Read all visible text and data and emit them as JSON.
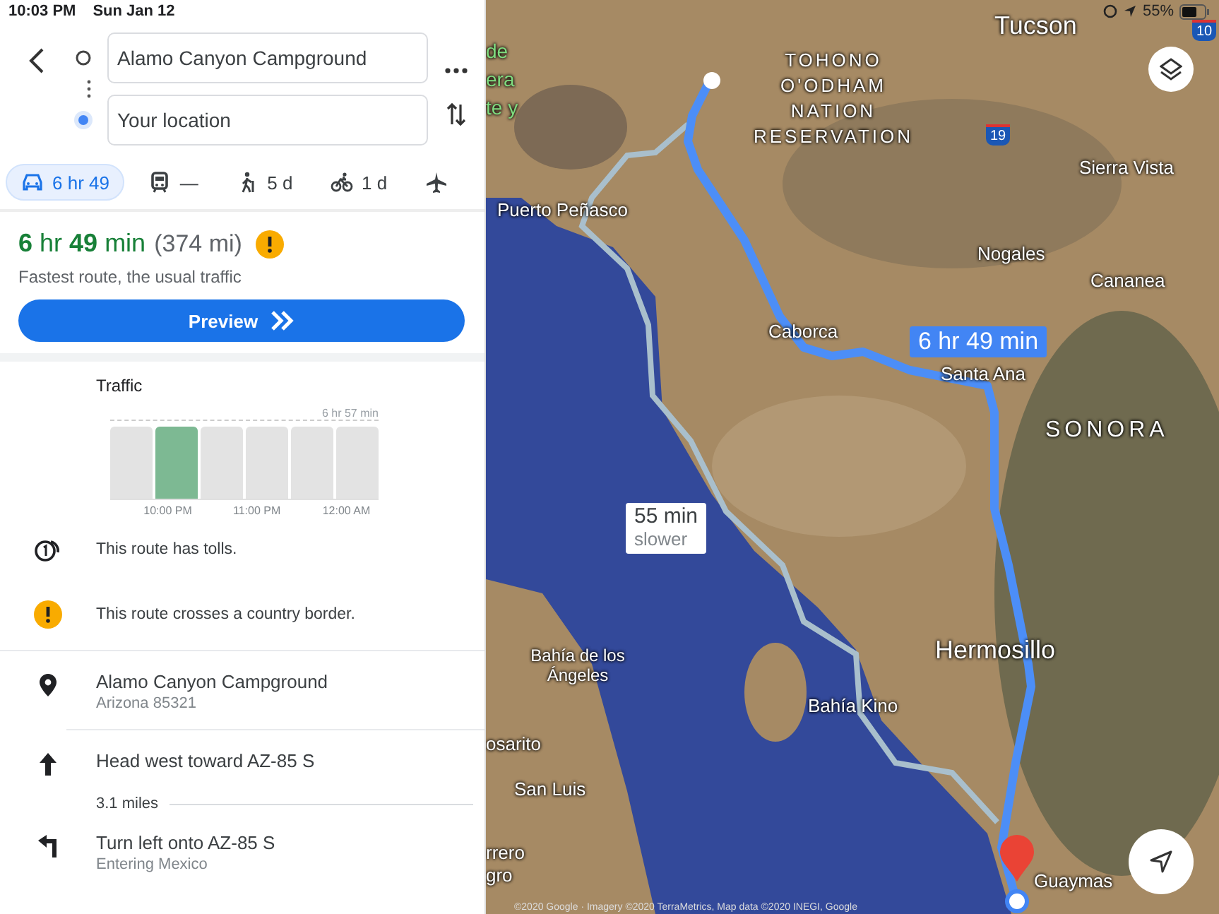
{
  "status_bar": {
    "time": "10:03 PM",
    "date": "Sun Jan 12",
    "battery": "55%"
  },
  "route_inputs": [
    {
      "kind": "origin",
      "value": "Alamo Canyon Campground"
    },
    {
      "kind": "destination",
      "value": "Your location"
    }
  ],
  "modes": [
    {
      "kind": "car",
      "label": "6 hr 49",
      "selected": true
    },
    {
      "kind": "transit",
      "label": "—",
      "selected": false
    },
    {
      "kind": "walk",
      "label": "5 d",
      "selected": false
    },
    {
      "kind": "bike",
      "label": "1 d",
      "selected": false
    },
    {
      "kind": "flight",
      "selected": false
    }
  ],
  "summary": {
    "duration": "**6** hr **49** min",
    "distance": "(374 mi)",
    "note": "Fastest route, the usual traffic",
    "button": "Preview"
  },
  "traffic": {
    "title": "Traffic",
    "peak_label": "6 hr 57 min",
    "bars": [
      {
        "selected": false
      },
      {
        "selected": true
      },
      {
        "selected": false
      },
      {
        "selected": false
      },
      {
        "selected": false
      },
      {
        "selected": false
      }
    ],
    "times": [
      "10:00 PM",
      "11:00 PM",
      "12:00 AM"
    ]
  },
  "notices": [
    {
      "kind": "tolls",
      "text": "This route has tolls."
    },
    {
      "kind": "warning",
      "text": "This route crosses a country border."
    }
  ],
  "steps": [
    {
      "kind": "pin",
      "title": "Alamo Canyon Campground",
      "subtitle": "Arizona 85321"
    },
    {
      "kind": "straight",
      "title": "Head west toward AZ-85 S",
      "distance": "3.1 miles"
    },
    {
      "kind": "turn-left",
      "title": "Turn left onto AZ-85 S",
      "subtitle": "Entering Mexico"
    }
  ],
  "map": {
    "labels": [
      {
        "kind": "park",
        "text": "de"
      },
      {
        "kind": "park",
        "text": "era"
      },
      {
        "kind": "park",
        "text": "te y"
      },
      {
        "kind": "big",
        "text": "Tucson"
      },
      {
        "kind": "region",
        "text": "TOHONO O'ODHAM NATION RESERVATION"
      },
      {
        "kind": "city",
        "text": "Sierra Vista"
      },
      {
        "kind": "city",
        "text": "Puerto Peñasco"
      },
      {
        "kind": "city",
        "text": "Nogales"
      },
      {
        "kind": "city",
        "text": "Cananea"
      },
      {
        "kind": "city",
        "text": "Caborca"
      },
      {
        "kind": "city",
        "text": "Santa Ana"
      },
      {
        "kind": "region",
        "text": "SONORA"
      },
      {
        "kind": "big",
        "text": "Hermosillo"
      },
      {
        "kind": "city",
        "text": "Bahía de los Ángeles"
      },
      {
        "kind": "city",
        "text": "Bahía Kino"
      },
      {
        "kind": "city",
        "text": "osarito"
      },
      {
        "kind": "city",
        "text": "San Luis"
      },
      {
        "kind": "city",
        "text": "rrero"
      },
      {
        "kind": "city",
        "text": "gro"
      },
      {
        "kind": "city",
        "text": "Guaymas"
      }
    ],
    "callouts": [
      {
        "kind": "primary",
        "title": "6 hr 49 min"
      },
      {
        "kind": "alternate",
        "title": "55 min",
        "subtitle": "slower"
      }
    ],
    "shields": [
      "19",
      "10"
    ],
    "copyright": "©2020 Google · Imagery ©2020 TerraMetrics, Map data ©2020 INEGI, Google"
  }
}
